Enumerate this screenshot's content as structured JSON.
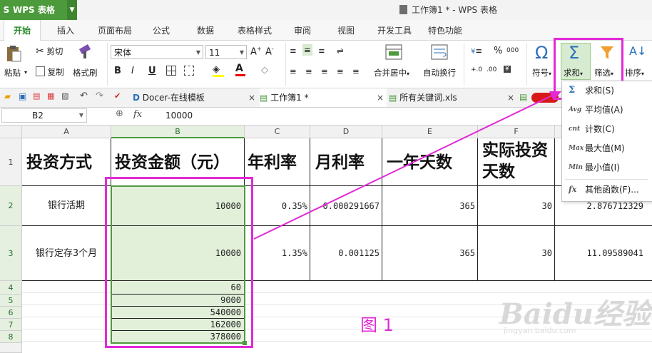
{
  "app": {
    "name": "WPS 表格",
    "window_title": "工作簿1 * - WPS 表格"
  },
  "menu": {
    "items": [
      "开始",
      "插入",
      "页面布局",
      "公式",
      "数据",
      "表格样式",
      "审阅",
      "视图",
      "开发工具",
      "特色功能"
    ],
    "active": "开始"
  },
  "ribbon": {
    "paste": "粘贴",
    "cut": "剪切",
    "copy": "复制",
    "format_painter": "格式刷",
    "font_name": "宋体",
    "font_size": "11",
    "merge_center": "合并居中",
    "wrap_text": "自动换行",
    "symbol": "符号",
    "sum": "求和",
    "filter": "筛选",
    "sort": "排序",
    "percent_glyph": "%",
    "thousands_glyph": "000"
  },
  "tabs": [
    {
      "label": "Docer-在线模板"
    },
    {
      "label": "工作簿1 *"
    },
    {
      "label": "所有关键词.xls"
    }
  ],
  "formula_bar": {
    "cell_ref": "B2",
    "fx": "fx",
    "value": "10000"
  },
  "grid": {
    "columns": [
      "A",
      "B",
      "C",
      "D",
      "E",
      "F"
    ],
    "rows": [
      "1",
      "2",
      "3",
      "4",
      "5",
      "6",
      "7",
      "8"
    ],
    "header_row": [
      "投资方式",
      "投资金额（元）",
      "年利率",
      "月利率",
      "一年天数",
      "实际投资天数"
    ],
    "row2": {
      "a": "银行活期",
      "b": "10000",
      "c": "0.35%",
      "d": "0.000291667",
      "e": "365",
      "f": "30",
      "g": "2.876712329"
    },
    "row3": {
      "a": "银行定存3个月",
      "b": "10000",
      "c": "1.35%",
      "d": "0.001125",
      "e": "365",
      "f": "30",
      "g": "11.09589041"
    },
    "b_values": [
      "60",
      "9000",
      "540000",
      "162000",
      "378000"
    ]
  },
  "sum_menu": {
    "items": [
      {
        "icon": "Σ",
        "label": "求和(S)"
      },
      {
        "icon": "Avg",
        "label": "平均值(A)"
      },
      {
        "icon": "cnt",
        "label": "计数(C)"
      },
      {
        "icon": "Max",
        "label": "最大值(M)"
      },
      {
        "icon": "Min",
        "label": "最小值(I)"
      },
      {
        "icon": "fx",
        "label": "其他函数(F)..."
      }
    ]
  },
  "annotation": {
    "figure_label": "图 1",
    "color": "#e22ad6"
  },
  "watermark": {
    "text": "Baidu经验",
    "url": "jingyan.baidu.com"
  },
  "colors": {
    "wps_green": "#4c9a3c",
    "selection_fill": "#e2f0d9"
  }
}
